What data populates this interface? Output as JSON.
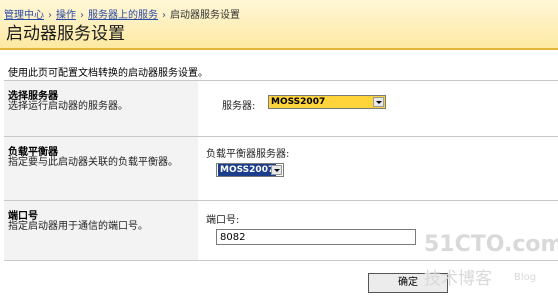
{
  "breadcrumb": {
    "items": [
      "管理中心",
      "操作",
      "服务器上的服务"
    ],
    "current": "启动器服务设置",
    "separator": "›"
  },
  "page": {
    "title": "启动器服务设置",
    "intro": "使用此页可配置文档转换的启动器服务设置。"
  },
  "sections": {
    "server": {
      "title": "选择服务器",
      "description": "选择运行启动器的服务器。",
      "label": "服务器:",
      "value": "MOSS2007"
    },
    "load_balancer": {
      "title": "负载平衡器",
      "description": "指定要与此启动器关联的负载平衡器。",
      "label": "负载平衡器服务器:",
      "value": "MOSS2007"
    },
    "port": {
      "title": "端口号",
      "description": "指定启动器用于通信的端口号。",
      "label": "端口号:",
      "value": "8082"
    }
  },
  "buttons": {
    "ok": "确定"
  },
  "watermark": {
    "site": "51CTO.com",
    "tagline": "技术博客",
    "blog": "Blog"
  },
  "colors": {
    "header_bg": "#fde9a2",
    "header_border": "#e3b63a",
    "select_highlight": "#ffd33a"
  }
}
